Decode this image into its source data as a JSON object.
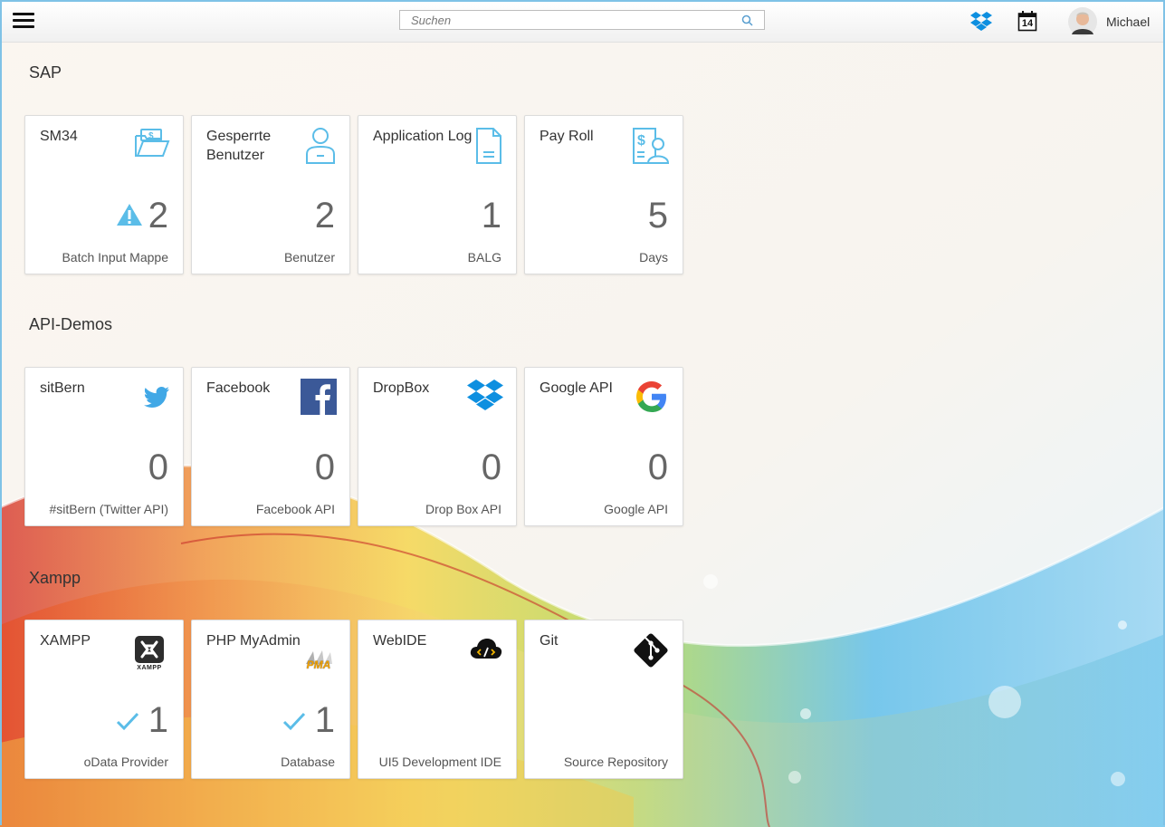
{
  "header": {
    "menu_icon": "hamburger-icon",
    "search_placeholder": "Suchen",
    "search_icon": "search-icon",
    "dropbox_icon": "dropbox-icon",
    "calendar_day": "14",
    "user_name": "Michael"
  },
  "groups": [
    {
      "title": "SAP",
      "tiles": [
        {
          "title": "SM34",
          "icon": "money-folder-icon",
          "number": "2",
          "indicator": "warning",
          "footer": "Batch Input Mappe"
        },
        {
          "title": "Gesperrte Benutzer",
          "icon": "locked-user-icon",
          "number": "2",
          "footer": "Benutzer"
        },
        {
          "title": "Application Log",
          "icon": "document-icon",
          "number": "1",
          "footer": "BALG"
        },
        {
          "title": "Pay Roll",
          "icon": "payroll-icon",
          "number": "5",
          "footer": "Days"
        }
      ]
    },
    {
      "title": "API-Demos",
      "tiles": [
        {
          "title": "sitBern",
          "icon": "twitter-icon",
          "number": "0",
          "footer": "#sitBern (Twitter API)"
        },
        {
          "title": "Facebook",
          "icon": "facebook-icon",
          "number": "0",
          "footer": "Facebook API"
        },
        {
          "title": "DropBox",
          "icon": "dropbox-icon",
          "number": "0",
          "footer": "Drop Box API"
        },
        {
          "title": "Google API",
          "icon": "google-icon",
          "number": "0",
          "footer": "Google API"
        }
      ]
    },
    {
      "title": "Xampp",
      "tiles": [
        {
          "title": "XAMPP",
          "icon": "xampp-logo-icon",
          "logo_text": "XAMPP",
          "number": "1",
          "indicator": "check",
          "footer": "oData Provider"
        },
        {
          "title": "PHP MyAdmin",
          "icon": "phpmyadmin-logo-icon",
          "logo_text": "PMA",
          "number": "1",
          "indicator": "check",
          "footer": "Database"
        },
        {
          "title": "WebIDE",
          "icon": "cloud-code-icon",
          "number": "",
          "footer": "UI5 Development IDE"
        },
        {
          "title": "Git",
          "icon": "git-icon",
          "number": "",
          "footer": "Source Repository"
        }
      ]
    }
  ],
  "colors": {
    "accent": "#5bbde8",
    "facebook": "#3b5998",
    "dropbox": "#0d8fe0"
  }
}
